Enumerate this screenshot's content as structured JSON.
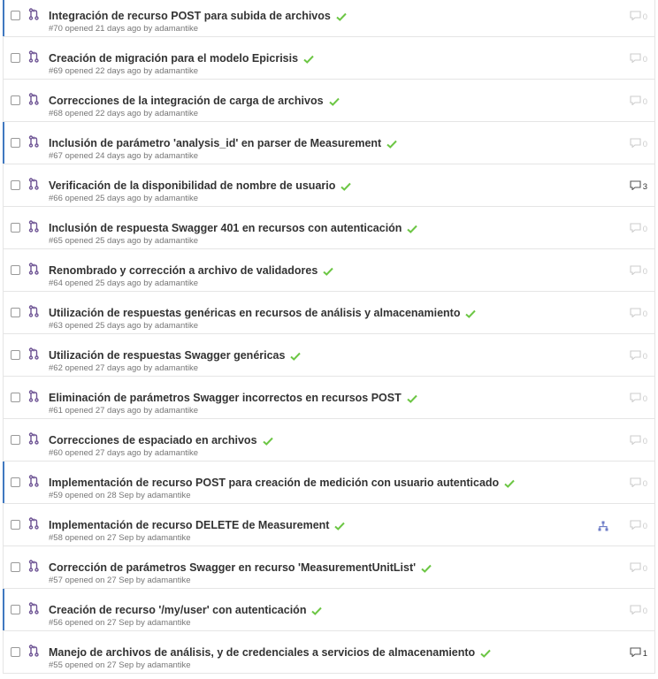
{
  "colors": {
    "accent": "#4078c0",
    "success": "#6cc644",
    "pr_icon": "#6e5494",
    "muted": "#767676"
  },
  "icons": {
    "pr": "git-pull-request-icon",
    "status": "check-icon",
    "comment": "comment-icon",
    "milestone": "sitemap-icon"
  },
  "issues": [
    {
      "title": "Integración de recurso POST para subida de archivos",
      "meta": "#70 opened 21 days ago by adamantike",
      "comments": "0",
      "unread": true
    },
    {
      "title": "Creación de migración para el modelo Epicrisis",
      "meta": "#69 opened 22 days ago by adamantike",
      "comments": "0",
      "unread": false
    },
    {
      "title": "Correcciones de la integración de carga de archivos",
      "meta": "#68 opened 22 days ago by adamantike",
      "comments": "0",
      "unread": false
    },
    {
      "title": "Inclusión de parámetro 'analysis_id' en parser de Measurement",
      "meta": "#67 opened 24 days ago by adamantike",
      "comments": "0",
      "unread": true
    },
    {
      "title": "Verificación de la disponibilidad de nombre de usuario",
      "meta": "#66 opened 25 days ago by adamantike",
      "comments": "3",
      "unread": false
    },
    {
      "title": "Inclusión de respuesta Swagger 401 en recursos con autenticación",
      "meta": "#65 opened 25 days ago by adamantike",
      "comments": "0",
      "unread": false
    },
    {
      "title": "Renombrado y corrección a archivo de validadores",
      "meta": "#64 opened 25 days ago by adamantike",
      "comments": "0",
      "unread": false
    },
    {
      "title": "Utilización de respuestas genéricas en recursos de análisis y almacenamiento",
      "meta": "#63 opened 25 days ago by adamantike",
      "comments": "0",
      "unread": false
    },
    {
      "title": "Utilización de respuestas Swagger genéricas",
      "meta": "#62 opened 27 days ago by adamantike",
      "comments": "0",
      "unread": false
    },
    {
      "title": "Eliminación de parámetros Swagger incorrectos en recursos POST",
      "meta": "#61 opened 27 days ago by adamantike",
      "comments": "0",
      "unread": false
    },
    {
      "title": "Correcciones de espaciado en archivos",
      "meta": "#60 opened 27 days ago by adamantike",
      "comments": "0",
      "unread": false
    },
    {
      "title": "Implementación de recurso POST para creación de medición con usuario autenticado",
      "meta": "#59 opened on 28 Sep by adamantike",
      "comments": "0",
      "unread": true
    },
    {
      "title": "Implementación de recurso DELETE de Measurement",
      "meta": "#58 opened on 27 Sep by adamantike",
      "comments": "0",
      "unread": false,
      "milestone": true
    },
    {
      "title": "Corrección de parámetros Swagger en recurso 'MeasurementUnitList'",
      "meta": "#57 opened on 27 Sep by adamantike",
      "comments": "0",
      "unread": false
    },
    {
      "title": "Creación de recurso '/my/user' con autenticación",
      "meta": "#56 opened on 27 Sep by adamantike",
      "comments": "0",
      "unread": true
    },
    {
      "title": "Manejo de archivos de análisis, y de credenciales a servicios de almacenamiento",
      "meta": "#55 opened on 27 Sep by adamantike",
      "comments": "1",
      "unread": false
    }
  ]
}
